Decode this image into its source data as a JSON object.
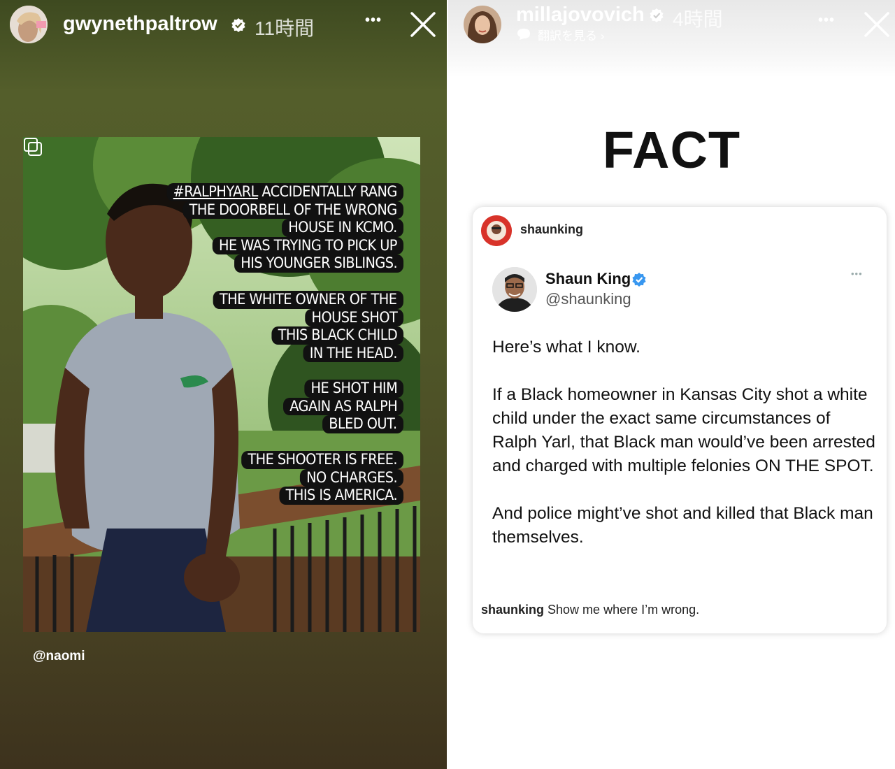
{
  "left_story": {
    "username": "gwynethpaltrow",
    "time_ago": "11時間",
    "more_label": "•••",
    "caption": {
      "hashtag": "#RALPHYARL",
      "block1": [
        " ACCIDENTALLY RANG",
        "THE DOORBELL OF THE WRONG",
        "HOUSE IN KCMO.",
        "HE WAS TRYING TO PICK UP",
        "HIS YOUNGER SIBLINGS."
      ],
      "block2": [
        "THE WHITE OWNER OF THE",
        "HOUSE SHOT",
        "THIS BLACK CHILD",
        "IN THE HEAD."
      ],
      "block3": [
        "HE SHOT HIM",
        "AGAIN AS RALPH",
        "BLED OUT."
      ],
      "block4": [
        "THE SHOOTER IS FREE.",
        "NO CHARGES.",
        "THIS IS AMERICA."
      ]
    },
    "mention": "@naomi"
  },
  "right_story": {
    "username": "millajovovich",
    "time_ago": "4時間",
    "translate_label": "翻訳を見る",
    "more_label": "•••",
    "headline": "FACT",
    "post": {
      "author": "shaunking",
      "tweet": {
        "display_name": "Shaun King",
        "handle": "@shaunking",
        "more_label": "•••",
        "paragraphs": [
          "Here’s what I know.",
          "If a Black homeowner in Kansas City shot a white child under the exact same circumstances of Ralph Yarl, that Black man would’ve been arrested and charged with multiple felonies ON THE SPOT.",
          "And police might’ve shot and killed that Black man themselves."
        ]
      },
      "caption_user": "shaunking",
      "caption_text": "Show me where I’m wrong."
    }
  },
  "colors": {
    "left_bg_top": "#545e2b",
    "left_bg_bottom": "#3d321d",
    "verified_blue": "#3897f0",
    "caption_bg": "#111111"
  },
  "icons": [
    "verified-badge-icon",
    "more-icon",
    "close-icon",
    "reshare-icon",
    "translate-icon",
    "chevron-right-icon"
  ]
}
